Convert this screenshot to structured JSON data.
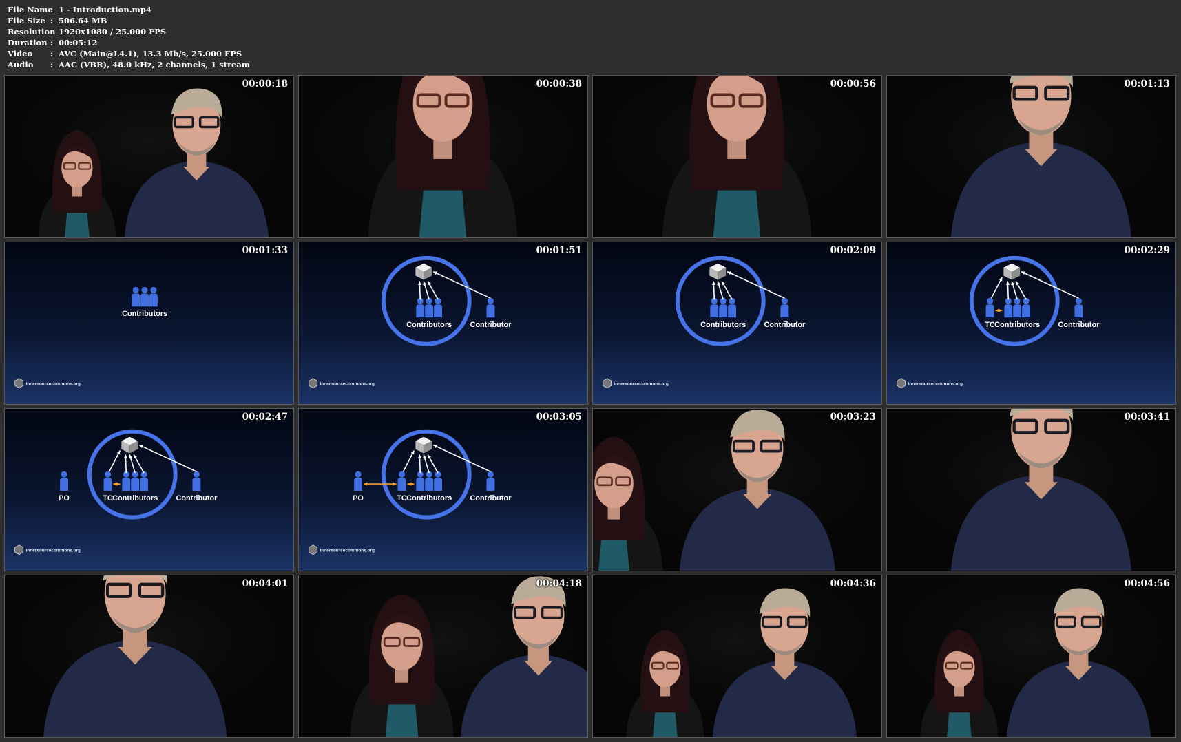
{
  "info": {
    "rows": [
      {
        "label": "File Name",
        "value": "1 - Introduction.mp4"
      },
      {
        "label": "File Size",
        "value": "506.64 MB"
      },
      {
        "label": "Resolution",
        "value": "1920x1080 / 25.000 FPS"
      },
      {
        "label": "Duration",
        "value": "00:05:12"
      },
      {
        "label": "Video",
        "value": "AVC (Main@L4.1), 13.3 Mb/s, 25.000 FPS"
      },
      {
        "label": "Audio",
        "value": "AAC (VBR), 48.0 kHz, 2 channels, 1 stream"
      }
    ],
    "separator": ":"
  },
  "slide": {
    "labels": {
      "contributors": "Contributors",
      "contributor": "Contributor",
      "tc": "TC",
      "po": "PO"
    },
    "footer": "innersourcecommons.org",
    "colors": {
      "person": "#3f6fe0",
      "ring": "#4674e8",
      "arrow": "#ffffff",
      "handshake": "#f0a030"
    }
  },
  "thumbnails": [
    {
      "time": "00:00:18",
      "kind": "video",
      "scene": "two-shot"
    },
    {
      "time": "00:00:38",
      "kind": "video",
      "scene": "woman-close"
    },
    {
      "time": "00:00:56",
      "kind": "video",
      "scene": "woman-close"
    },
    {
      "time": "00:01:13",
      "kind": "video",
      "scene": "man-close"
    },
    {
      "time": "00:01:33",
      "kind": "slide",
      "scene": "contributors"
    },
    {
      "time": "00:01:51",
      "kind": "slide",
      "scene": "ring"
    },
    {
      "time": "00:02:09",
      "kind": "slide",
      "scene": "ring"
    },
    {
      "time": "00:02:29",
      "kind": "slide",
      "scene": "ring-tc"
    },
    {
      "time": "00:02:47",
      "kind": "slide",
      "scene": "ring-tc-po"
    },
    {
      "time": "00:03:05",
      "kind": "slide",
      "scene": "ring-tc-po-link"
    },
    {
      "time": "00:03:23",
      "kind": "video",
      "scene": "man-with-woman-left"
    },
    {
      "time": "00:03:41",
      "kind": "video",
      "scene": "man-close"
    },
    {
      "time": "00:04:01",
      "kind": "video",
      "scene": "man-close-left"
    },
    {
      "time": "00:04:18",
      "kind": "video",
      "scene": "woman-man-right"
    },
    {
      "time": "00:04:36",
      "kind": "video",
      "scene": "two-shot"
    },
    {
      "time": "00:04:56",
      "kind": "video",
      "scene": "two-shot"
    }
  ]
}
